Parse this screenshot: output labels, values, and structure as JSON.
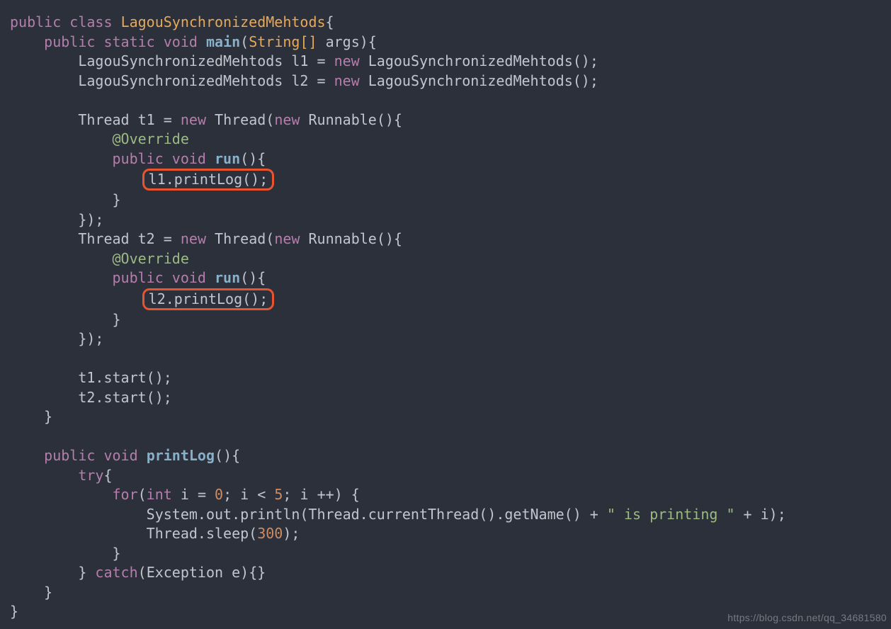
{
  "watermark": "https://blog.csdn.net/qq_34681580",
  "kw": {
    "public": "public",
    "class": "class",
    "static": "static",
    "void": "void",
    "new": "new",
    "for": "for",
    "int": "int",
    "try": "try",
    "catch": "catch"
  },
  "ann": {
    "override": "@Override"
  },
  "cls": {
    "name": "LagouSynchronizedMehtods",
    "thread": "Thread",
    "runnable": "Runnable",
    "string_arr": "String[]",
    "exception": "Exception"
  },
  "fn": {
    "main": "main",
    "run": "run",
    "printLog": "printLog"
  },
  "id": {
    "args": "args",
    "l1": "l1",
    "l2": "l2",
    "t1": "t1",
    "t2": "t2",
    "i": "i",
    "e": "e"
  },
  "call": {
    "l1_printLog": "l1.printLog();",
    "l2_printLog": "l2.printLog();",
    "t1_start": "t1.start();",
    "t2_start": "t2.start();",
    "sys_out": "System.out.println(Thread.currentThread().getName() + ",
    "sys_out_tail": " + i);",
    "thread_sleep_head": "Thread.sleep(",
    "thread_sleep_tail": ");"
  },
  "str": {
    "is_printing": "\" is printing \""
  },
  "num": {
    "zero": "0",
    "five": "5",
    "three_hundred": "300"
  },
  "sym": {
    "ob": "{",
    "cb": "}",
    "op": "(",
    "cp": ")",
    "eq": "=",
    "semi": ";",
    "lt": "<",
    "pp": "++",
    "comma": ","
  }
}
